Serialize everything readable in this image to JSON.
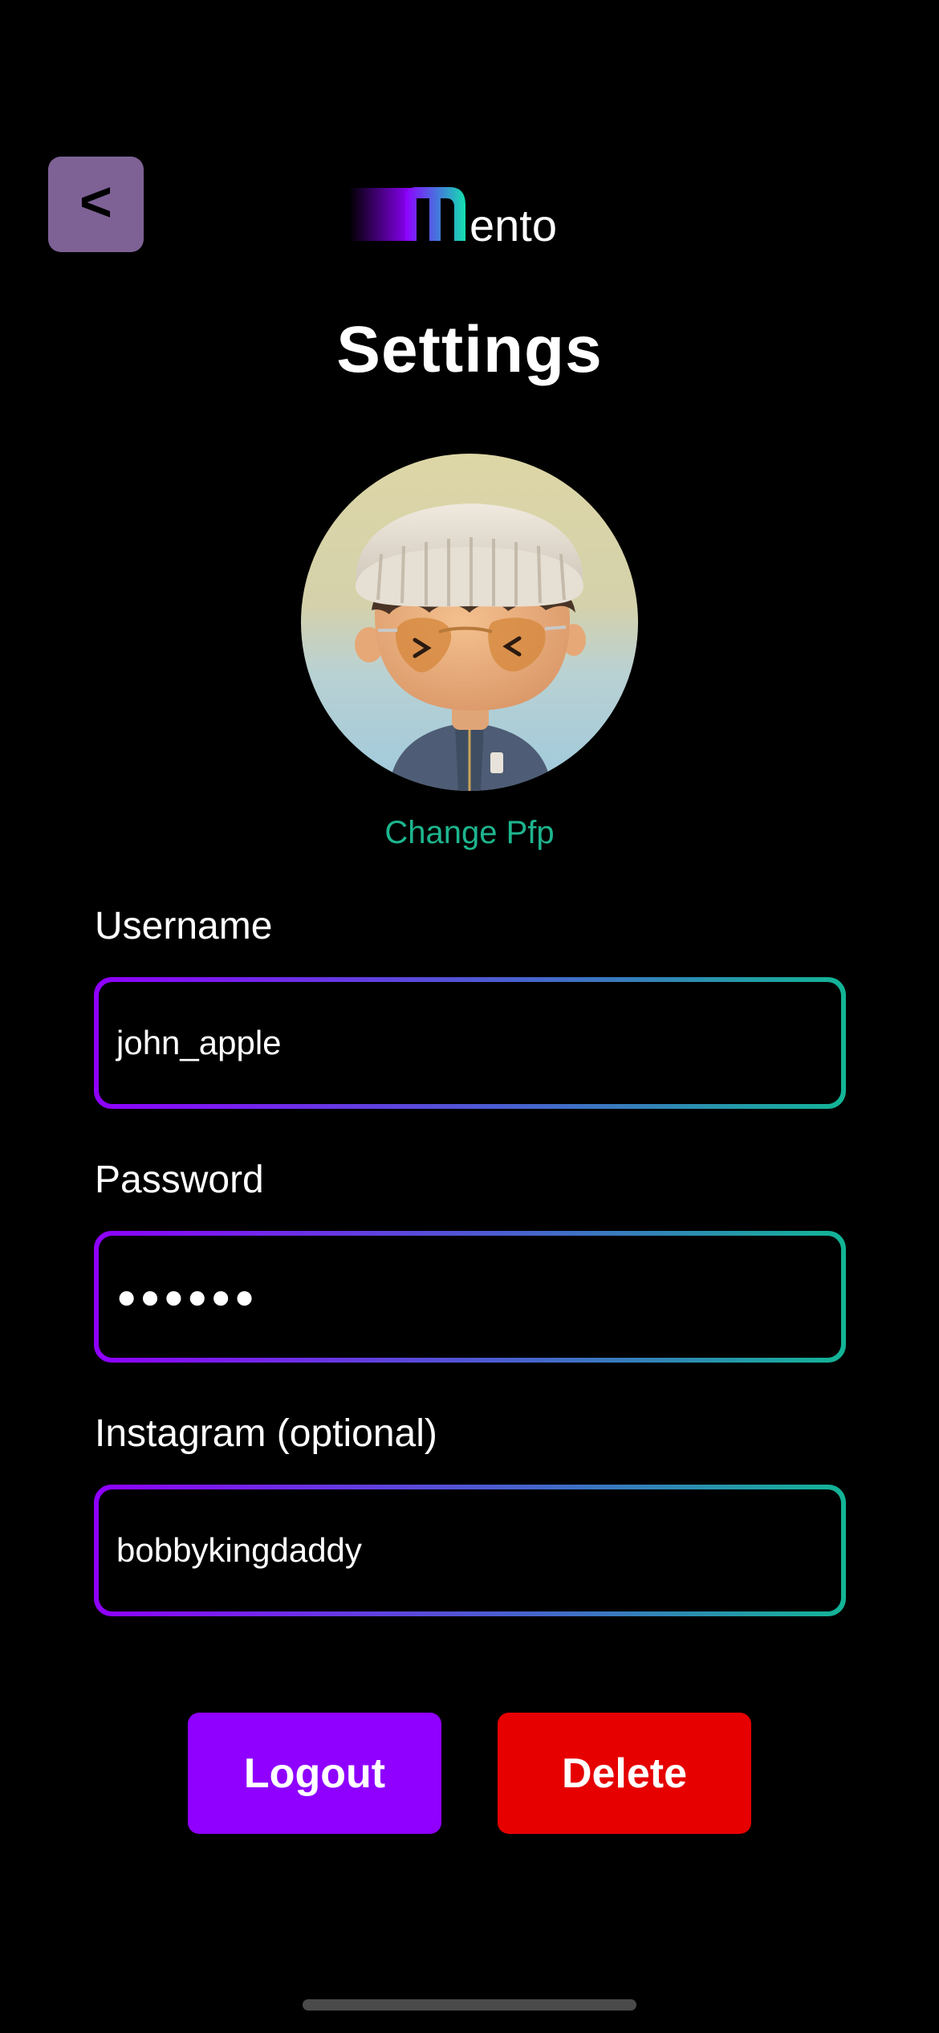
{
  "header": {
    "back_label": "<",
    "logo_text": "ento",
    "logo_letter": "m"
  },
  "title": "Settings",
  "profile": {
    "change_pfp_label": "Change Pfp"
  },
  "fields": {
    "username": {
      "label": "Username",
      "value": "john_apple"
    },
    "password": {
      "label": "Password",
      "value": "●●●●●●"
    },
    "instagram": {
      "label": "Instagram (optional)",
      "value": "bobbykingdaddy"
    }
  },
  "buttons": {
    "logout": "Logout",
    "delete": "Delete"
  },
  "colors": {
    "accent_purple": "#8f00ff",
    "accent_teal": "#12b596",
    "danger_red": "#e60000",
    "back_button": "#7e6296",
    "link_green": "#1db58e"
  }
}
